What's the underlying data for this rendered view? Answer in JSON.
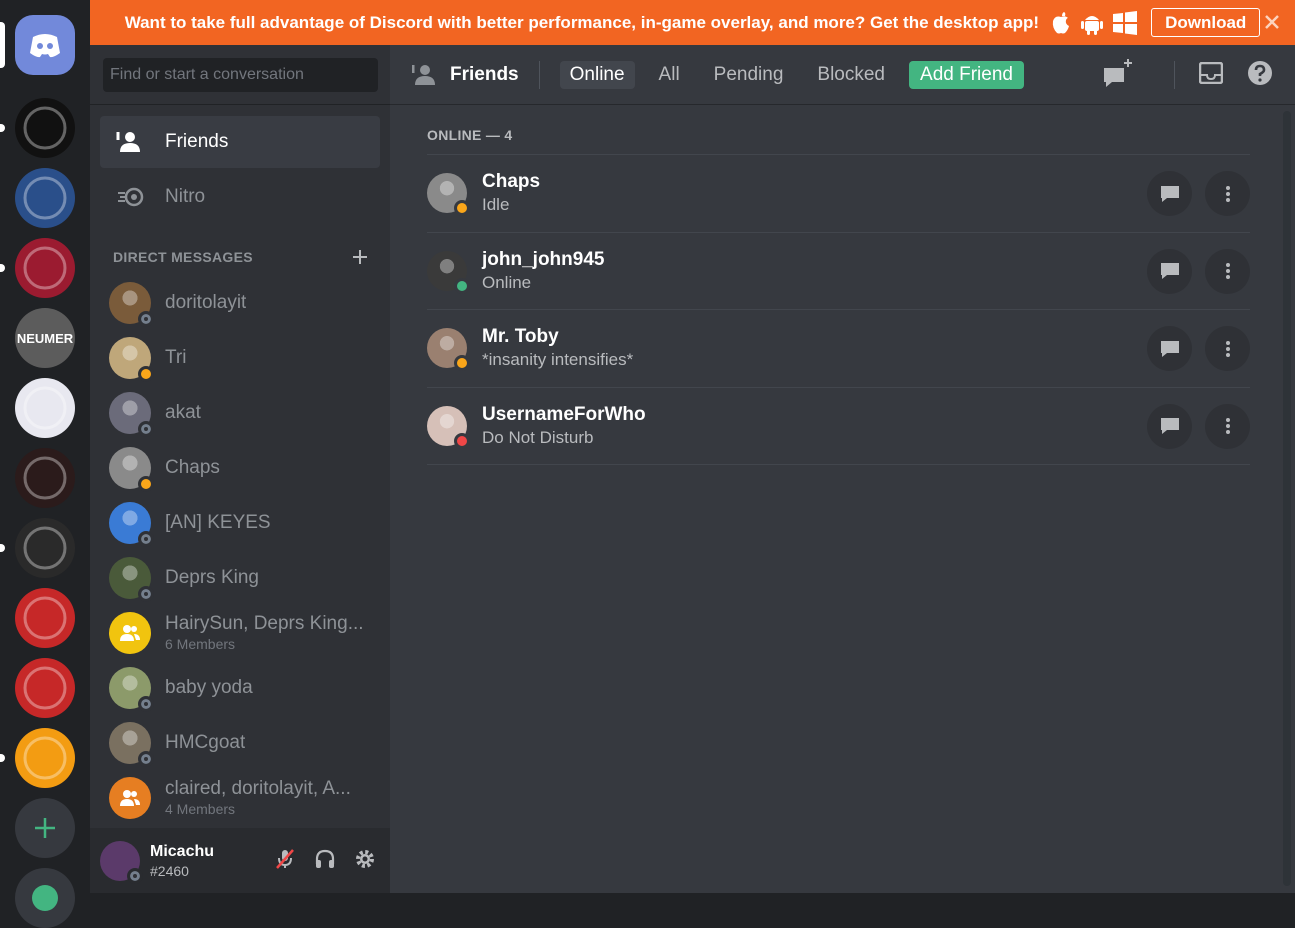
{
  "banner": {
    "message": "Want to take full advantage of Discord with better performance, in-game overlay, and more? Get the desktop app!",
    "download_label": "Download"
  },
  "servers": [
    {
      "name": "Home",
      "color": "#7289da"
    },
    {
      "name": "Server 1",
      "color": "#111111"
    },
    {
      "name": "Server 2",
      "color": "#2a4f8a"
    },
    {
      "name": "Server 3",
      "color": "#9b1b30"
    },
    {
      "name": "NEUMER",
      "color": "#5c5c5c",
      "label": "NEUMER"
    },
    {
      "name": "Server 5",
      "color": "#e8e8f0"
    },
    {
      "name": "Server 6",
      "color": "#2b1b1b"
    },
    {
      "name": "Server 7",
      "color": "#2a2a2a"
    },
    {
      "name": "Server 8",
      "color": "#c62828"
    },
    {
      "name": "Server 9",
      "color": "#c62828"
    },
    {
      "name": "Server 10",
      "color": "#f39c12"
    }
  ],
  "sidebar": {
    "search_placeholder": "Find or start a conversation",
    "nav": [
      {
        "label": "Friends"
      },
      {
        "label": "Nitro"
      }
    ],
    "dm_header": "DIRECT MESSAGES",
    "dms": [
      {
        "name": "doritolayit",
        "status": "offline",
        "color": "#7a5b3a"
      },
      {
        "name": "Tri",
        "status": "idle",
        "color": "#bfa77a"
      },
      {
        "name": "akat",
        "status": "offline",
        "color": "#6b6b7a"
      },
      {
        "name": "Chaps",
        "status": "idle",
        "color": "#8a8a8a"
      },
      {
        "name": "[AN] KEYES",
        "status": "offline",
        "color": "#3a7bd5"
      },
      {
        "name": "Deprs King",
        "status": "offline",
        "color": "#4a5a3a"
      },
      {
        "name": "HairySun, Deprs King...",
        "sub": "6 Members",
        "group": true,
        "color": "#f1c40f"
      },
      {
        "name": "baby yoda",
        "status": "offline",
        "color": "#8c9a6a"
      },
      {
        "name": "HMCgoat",
        "status": "offline",
        "color": "#7a7060"
      },
      {
        "name": "claired, doritolayit, A...",
        "sub": "4 Members",
        "group": true,
        "color": "#e67e22"
      }
    ]
  },
  "user": {
    "name": "Micachu",
    "tag": "#2460"
  },
  "topbar": {
    "title": "Friends",
    "tabs": [
      {
        "label": "Online",
        "selected": true
      },
      {
        "label": "All"
      },
      {
        "label": "Pending"
      },
      {
        "label": "Blocked"
      },
      {
        "label": "Add Friend",
        "add": true
      }
    ]
  },
  "friends": {
    "header": "ONLINE — 4",
    "list": [
      {
        "name": "Chaps",
        "status_text": "Idle",
        "status": "idle",
        "color": "#8a8a8a"
      },
      {
        "name": "john_john945",
        "status_text": "Online",
        "status": "online",
        "color": "#3a3a3a"
      },
      {
        "name": "Mr. Toby",
        "status_text": "*insanity intensifies*",
        "status": "idle",
        "color": "#9a8070"
      },
      {
        "name": "UsernameForWho",
        "status_text": "Do Not Disturb",
        "status": "dnd",
        "color": "#d6c0b8"
      }
    ]
  }
}
